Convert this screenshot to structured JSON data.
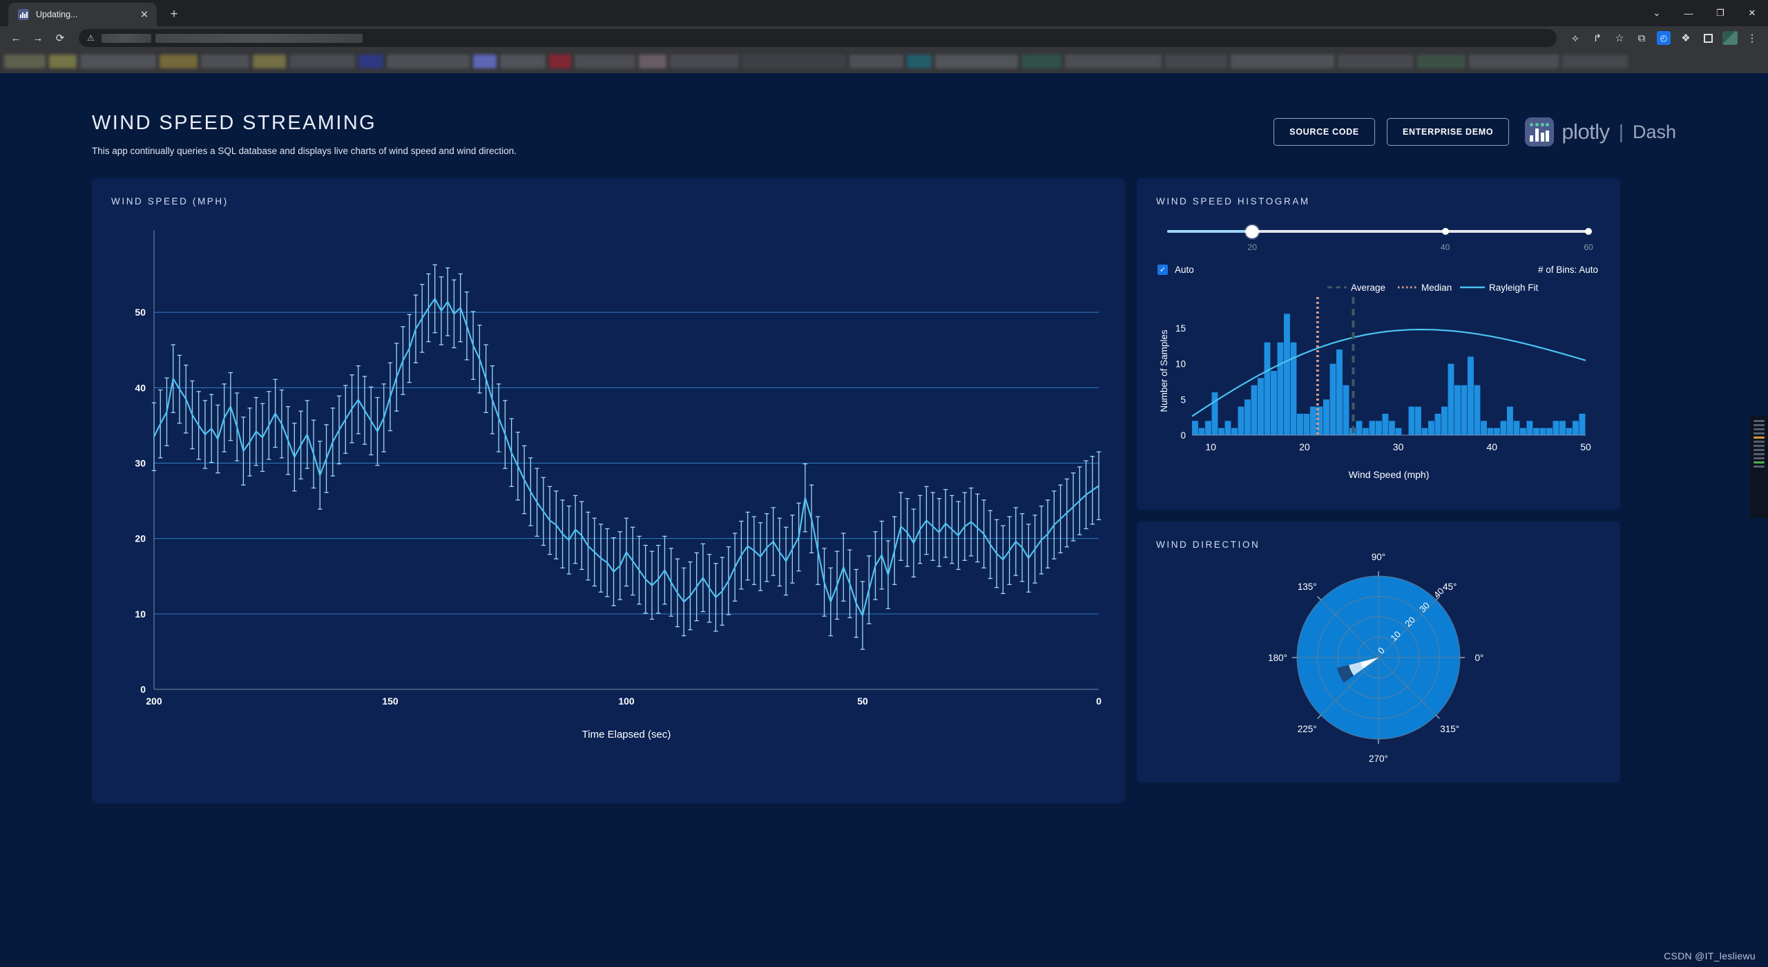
{
  "browser": {
    "tab_title": "Updating...",
    "tab_close_glyph": "✕",
    "newtab_glyph": "+",
    "window_controls": [
      "⌄",
      "—",
      "❐",
      "✕"
    ],
    "nav": {
      "back": "←",
      "forward": "→",
      "reload": "⟳"
    },
    "omnibox": {
      "warning_glyph": "⚠",
      "value": "",
      "placeholder": ""
    },
    "toolbar_right": {
      "translate": "⟡",
      "share": "↱",
      "bookmark_star": "☆",
      "split_screen": "⧉",
      "history_glyph": "◴",
      "extensions": "❖",
      "collections": "",
      "profile": "",
      "menu": "⋮"
    }
  },
  "header": {
    "title": "WIND SPEED STREAMING",
    "subtitle": "This app continually queries a SQL database and displays live charts of wind speed and wind direction.",
    "source_code_label": "SOURCE CODE",
    "enterprise_demo_label": "ENTERPRISE DEMO",
    "logo_word": "plotly",
    "logo_divider": "|",
    "logo_product": "Dash"
  },
  "cards": {
    "wind_speed_title": "WIND SPEED (MPH)",
    "histogram_title": "WIND SPEED HISTOGRAM",
    "direction_title": "WIND DIRECTION"
  },
  "histogram_controls": {
    "slider_value": 20,
    "slider_min": 0,
    "slider_max": 60,
    "slider_marks": [
      {
        "value": 20,
        "label": "20",
        "pos_pct": 32
      },
      {
        "value": 40,
        "label": "40",
        "pos_pct": 66
      },
      {
        "value": 60,
        "label": "60",
        "pos_pct": 100
      }
    ],
    "auto_checked": true,
    "auto_label": "Auto",
    "check_glyph": "✓",
    "bins_label": "# of Bins: Auto"
  },
  "watermark": "CSDN @IT_lesliewu",
  "colors": {
    "page_bg": "#061a3e",
    "card_bg": "#0b2253",
    "accent_line": "#4cc3f0",
    "bar_blue": "#1f8fe0",
    "polar_fill": "#0c7fd4",
    "average_dash": "#3f5a62",
    "median_dot": "#d89a80",
    "text_light": "#ffffff"
  },
  "chart_data": [
    {
      "type": "line",
      "name": "wind-speed-timeseries",
      "title": "WIND SPEED (MPH)",
      "xlabel": "Time Elapsed (sec)",
      "ylabel": "",
      "xticks": [
        200,
        150,
        100,
        50,
        0
      ],
      "yticks": [
        0,
        10,
        20,
        30,
        40,
        50
      ],
      "xlim": [
        200,
        0
      ],
      "ylim": [
        0,
        60
      ],
      "x_reversed": true,
      "grid": "horizontal",
      "error_bars": true,
      "y": [
        33.5,
        35.2,
        36.8,
        41.2,
        39.8,
        38.5,
        36.4,
        35.0,
        33.8,
        34.6,
        33.2,
        36.0,
        37.5,
        34.8,
        31.6,
        32.8,
        34.2,
        33.4,
        35.0,
        36.6,
        35.2,
        33.0,
        30.8,
        32.4,
        33.8,
        31.2,
        28.4,
        30.6,
        32.8,
        34.4,
        35.8,
        37.2,
        38.4,
        37.0,
        35.6,
        34.2,
        36.0,
        38.8,
        41.4,
        43.6,
        45.2,
        47.8,
        49.2,
        50.6,
        51.8,
        50.2,
        51.4,
        49.8,
        50.6,
        48.2,
        45.6,
        43.8,
        41.2,
        38.4,
        36.0,
        33.8,
        31.4,
        29.6,
        27.8,
        26.2,
        24.8,
        23.6,
        22.4,
        21.8,
        20.6,
        19.8,
        21.2,
        20.4,
        19.0,
        18.2,
        17.4,
        16.8,
        15.6,
        16.4,
        18.2,
        17.0,
        15.8,
        14.6,
        13.8,
        14.6,
        15.8,
        14.2,
        12.8,
        11.6,
        12.4,
        13.6,
        14.8,
        13.4,
        12.2,
        13.0,
        14.4,
        16.2,
        17.8,
        19.0,
        18.4,
        17.6,
        18.8,
        19.6,
        18.2,
        17.0,
        18.6,
        20.2,
        25.4,
        22.6,
        18.4,
        14.2,
        11.6,
        13.8,
        16.2,
        14.0,
        11.4,
        9.8,
        13.2,
        16.4,
        17.8,
        15.2,
        18.4,
        21.6,
        20.8,
        19.4,
        21.2,
        22.4,
        21.6,
        20.8,
        22.0,
        21.2,
        20.4,
        21.6,
        22.2,
        21.4,
        20.6,
        19.2,
        18.0,
        17.2,
        18.4,
        19.6,
        18.8,
        17.4,
        18.6,
        19.8,
        20.6,
        21.8,
        22.6,
        23.4,
        24.2,
        25.0,
        25.8,
        26.4,
        27.0
      ],
      "y_error": 4.5
    },
    {
      "type": "bar",
      "name": "wind-speed-histogram",
      "xlabel": "Wind Speed (mph)",
      "ylabel": "Number of Samples",
      "xticks": [
        10,
        20,
        30,
        40,
        50
      ],
      "yticks": [
        0,
        5,
        10,
        15
      ],
      "xlim": [
        8,
        50
      ],
      "ylim": [
        0,
        18
      ],
      "bin_start": 8,
      "bin_width": 0.7,
      "values": [
        2,
        1,
        2,
        6,
        1,
        2,
        1,
        4,
        5,
        7,
        8,
        13,
        9,
        13,
        17,
        13,
        3,
        3,
        4,
        4,
        5,
        10,
        12,
        7,
        1,
        2,
        1,
        2,
        2,
        3,
        2,
        1,
        0,
        4,
        4,
        1,
        2,
        3,
        4,
        10,
        7,
        7,
        11,
        7,
        2,
        1,
        1,
        2,
        4,
        2,
        1,
        2,
        1,
        1,
        1,
        2,
        2,
        1,
        2,
        3
      ],
      "legend": [
        {
          "label": "Average",
          "style": "dashed",
          "color": "#3f5a62"
        },
        {
          "label": "Median",
          "style": "dotted",
          "color": "#d89a80"
        },
        {
          "label": "Rayleigh Fit",
          "style": "solid",
          "color": "#4cc3f0"
        }
      ],
      "average_x": 25.2,
      "median_x": 21.4,
      "rayleigh_peak_x": 27.5,
      "rayleigh_peak_y": 14.8
    },
    {
      "type": "polar",
      "name": "wind-direction-polar",
      "angular_ticks": [
        "0°",
        "45°",
        "90°",
        "135°",
        "180°",
        "225°",
        "270°",
        "315°"
      ],
      "radial_ticks": [
        "0",
        "10",
        "20",
        "30",
        "40"
      ],
      "radial_max": 40,
      "background_r": 40,
      "wedge_center_deg": 205,
      "wedge_width_deg": 22,
      "segments": [
        {
          "r": 9,
          "color": "#ffffff"
        },
        {
          "r": 15,
          "color": "#c5e0f5"
        },
        {
          "r": 21,
          "color": "#1b4a80"
        }
      ]
    }
  ]
}
